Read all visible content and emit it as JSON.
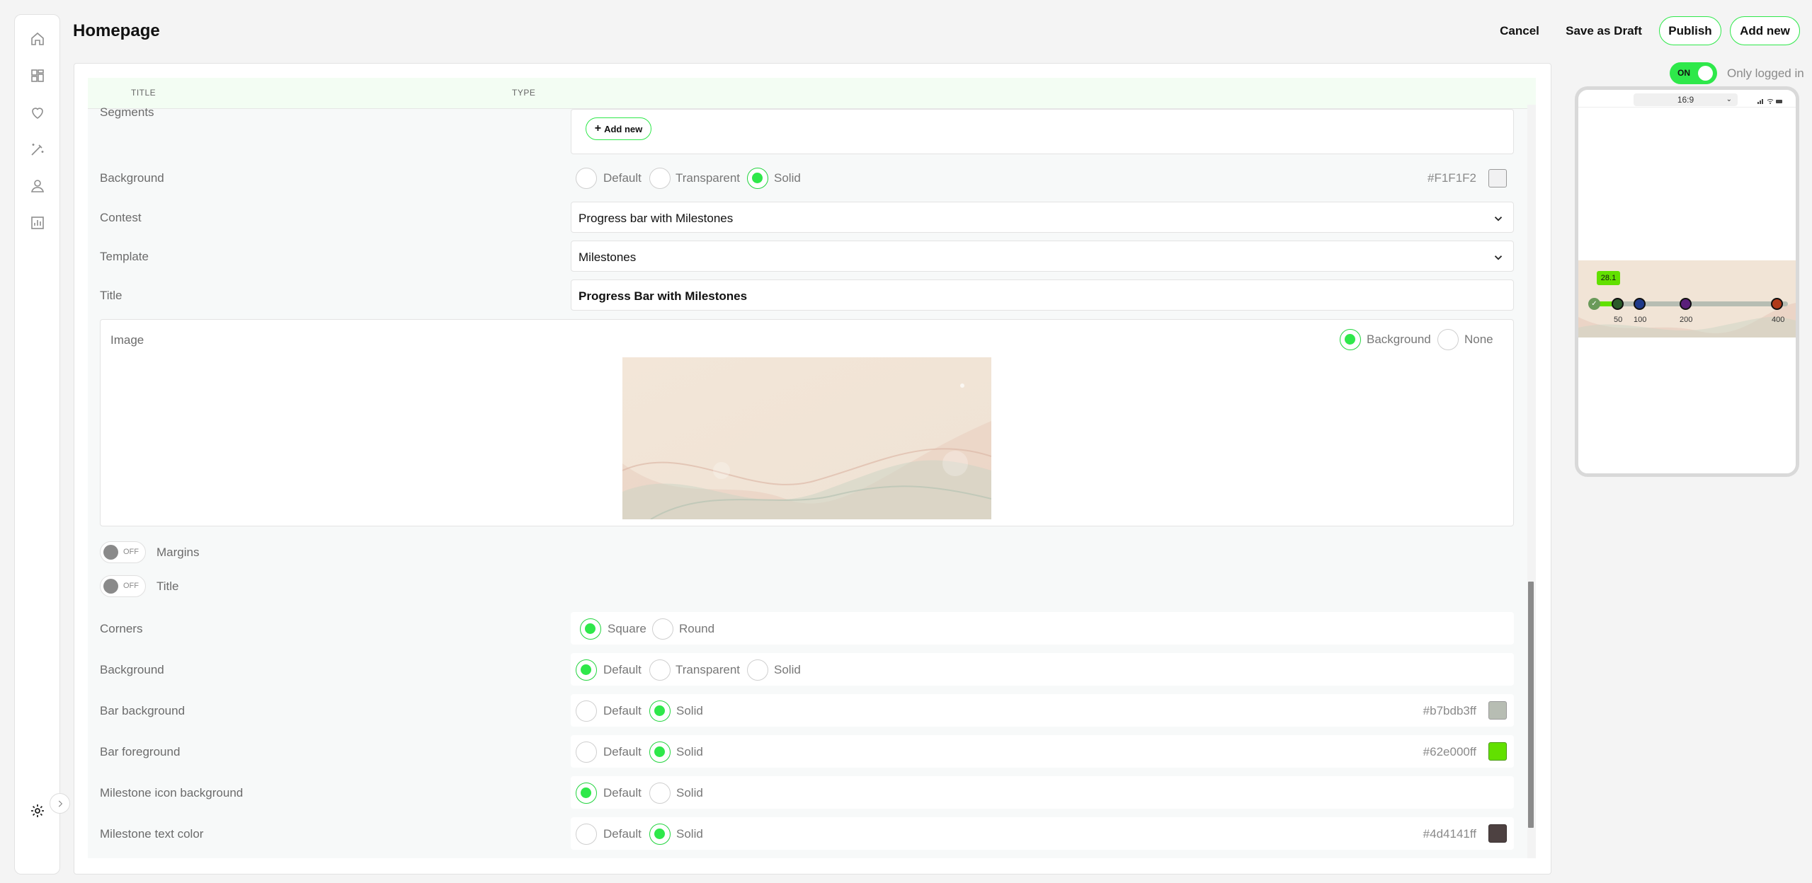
{
  "header": {
    "title": "Homepage",
    "cancel_label": "Cancel",
    "save_draft_label": "Save as Draft",
    "publish_label": "Publish",
    "add_new_label": "Add new"
  },
  "sidebar": {
    "items": [
      {
        "icon": "home-icon"
      },
      {
        "icon": "dashboard-icon"
      },
      {
        "icon": "heart-icon"
      },
      {
        "icon": "magic-wand-icon"
      },
      {
        "icon": "user-icon"
      },
      {
        "icon": "analytics-icon"
      }
    ],
    "settings_icon": "gear-icon",
    "collapse_icon": "chevron-right-icon"
  },
  "table": {
    "col_title": "TITLE",
    "col_type": "TYPE"
  },
  "form": {
    "segments": {
      "label": "Segments",
      "add_new_label": "Add new"
    },
    "background": {
      "label": "Background",
      "options": [
        "Default",
        "Transparent",
        "Solid"
      ],
      "selected": "Solid",
      "hex": "#F1F1F2",
      "swatch": "#f1f1f2"
    },
    "contest": {
      "label": "Contest",
      "value": "Progress bar with Milestones"
    },
    "template": {
      "label": "Template",
      "value": "Milestones"
    },
    "title": {
      "label": "Title",
      "value": "Progress Bar with Milestones"
    },
    "image": {
      "label": "Image",
      "options": [
        "Background",
        "None"
      ],
      "selected": "Background"
    },
    "margins": {
      "label": "Margins",
      "state": "OFF"
    },
    "title_toggle": {
      "label": "Title",
      "state": "OFF"
    },
    "corners": {
      "label": "Corners",
      "options": [
        "Square",
        "Round"
      ],
      "selected": "Square"
    },
    "background2": {
      "label": "Background",
      "options": [
        "Default",
        "Transparent",
        "Solid"
      ],
      "selected": "Default"
    },
    "bar_background": {
      "label": "Bar background",
      "options": [
        "Default",
        "Solid"
      ],
      "selected": "Solid",
      "hex": "#b7bdb3ff",
      "swatch": "#b7bdb3"
    },
    "bar_foreground": {
      "label": "Bar foreground",
      "options": [
        "Default",
        "Solid"
      ],
      "selected": "Solid",
      "hex": "#62e000ff",
      "swatch": "#62e000"
    },
    "milestone_icon_bg": {
      "label": "Milestone icon background",
      "options": [
        "Default",
        "Solid"
      ],
      "selected": "Default"
    },
    "milestone_text_color": {
      "label": "Milestone text color",
      "options": [
        "Default",
        "Solid"
      ],
      "selected": "Solid",
      "hex": "#4d4141ff",
      "swatch": "#4d4141"
    }
  },
  "preview": {
    "toggle_state": "ON",
    "only_logged_in_label": "Only logged in",
    "aspect_ratio": "16:9",
    "progress_value": "28.1",
    "milestones": [
      "50",
      "100",
      "200",
      "400"
    ]
  }
}
